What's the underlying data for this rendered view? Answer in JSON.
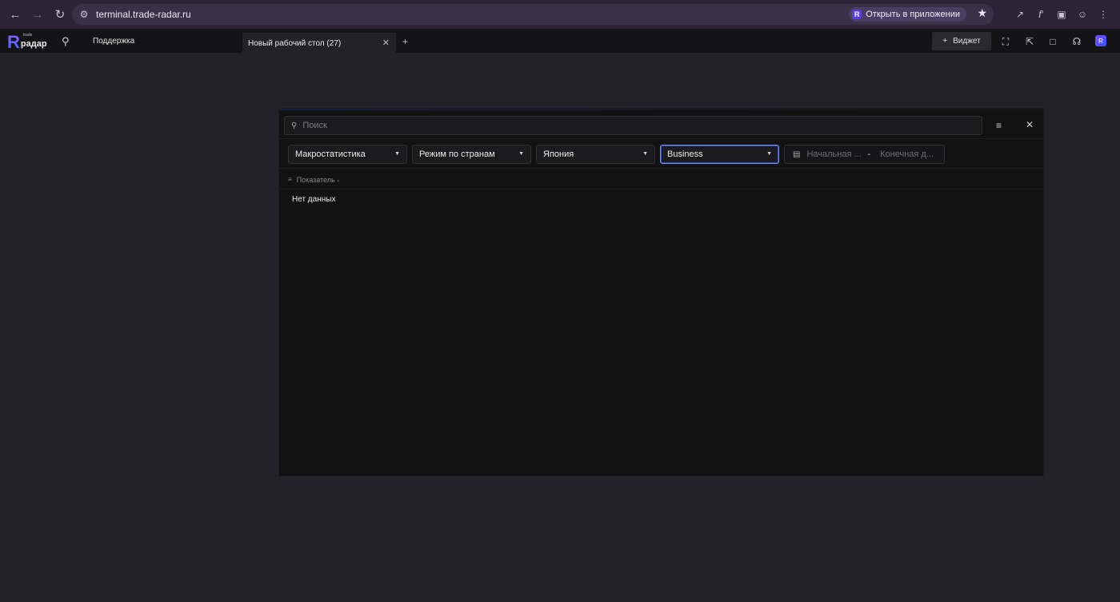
{
  "browser": {
    "url": "terminal.trade-radar.ru",
    "open_in_app_label": "Открыть в приложении",
    "open_in_app_badge": "R"
  },
  "app": {
    "logo_letter": "R",
    "logo_text": "радар",
    "logo_small_text": "trade",
    "support_label": "Поддержка",
    "tab_label": "Новый рабочий стол (27)",
    "widget_button_label": "Виджет",
    "avatar_letter": "R"
  },
  "widget": {
    "search_placeholder": "Поиск",
    "filters": [
      {
        "value": "Макростатистика"
      },
      {
        "value": "Режим по странам"
      },
      {
        "value": "Япония"
      },
      {
        "value": "Business"
      }
    ],
    "date_start_placeholder": "Начальная ...",
    "date_end_placeholder": "Конечная д...",
    "date_separator": "-",
    "column_header": "Показатель",
    "empty_text": "Нет данных"
  },
  "colors": {
    "accent": "#6a4cf0",
    "focus_border": "#6e8cff",
    "panel_bg": "#121212",
    "desktop_bg": "#23222b"
  }
}
